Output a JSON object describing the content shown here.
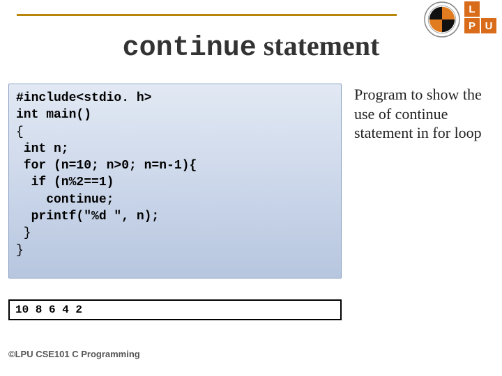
{
  "title": {
    "mono": "continue",
    "rest": " statement"
  },
  "code": {
    "l1": "#include<stdio. h>",
    "l2": "int main()",
    "l3": "{",
    "l4": " int n;",
    "l5": " for (n=10; n>0; n=n-1){",
    "l6": "  if (n%2==1)",
    "l7": "    continue;",
    "l8": "  printf(\"%d \", n);",
    "l9": " }",
    "l10": "}"
  },
  "annotation": "Program to show the use of continue statement in for loop",
  "output": "10 8 6 4 2",
  "footer": "©LPU CSE101 C Programming",
  "logo": {
    "t1": "L",
    "t2": "P",
    "t3": "U"
  }
}
